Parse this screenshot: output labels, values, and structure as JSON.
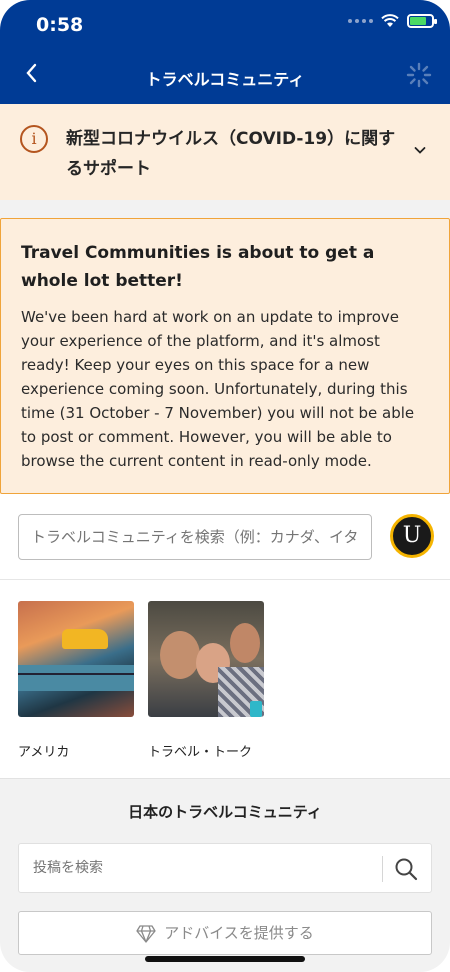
{
  "status_bar": {
    "time": "0:58"
  },
  "header": {
    "title": "トラベルコミュニティ",
    "background_color": "#003b95"
  },
  "covid_banner": {
    "text": "新型コロナウイルス（COVID-19）に関するサポート",
    "icon": "info-icon",
    "background_color": "#fdeedd"
  },
  "notice": {
    "heading": "Travel Communities is about to get a whole lot better!",
    "body": "We've been hard at work on an update to improve your experience of the platform, and it's almost ready! Keep your eyes on this space for a new experience coming soon. Unfortunately, during this time (31 October - 7 November) you will not be able to post or comment. However, you will be able to browse the current content in read-only mode.",
    "border_color": "#f0a43a"
  },
  "search": {
    "placeholder": "トラベルコミュニティを検索（例：カナダ、イタリア）"
  },
  "user": {
    "avatar_initial": "U"
  },
  "communities": [
    {
      "label": "アメリカ"
    },
    {
      "label": "トラベル・トーク"
    }
  ],
  "local_community": {
    "heading": "日本のトラベルコミュニティ",
    "search_placeholder": "投稿を検索",
    "advice_button": "アドバイスを提供する"
  }
}
